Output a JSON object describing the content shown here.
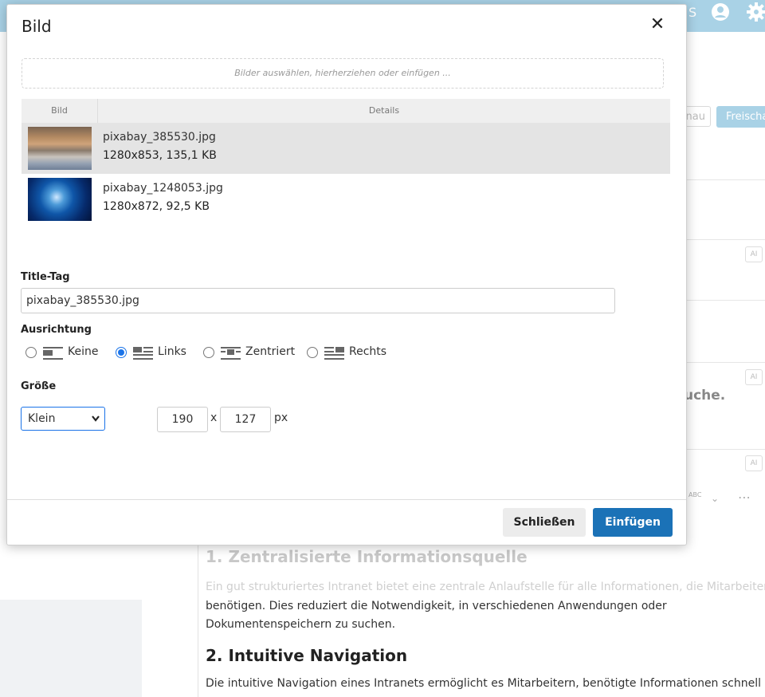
{
  "background": {
    "header_icons": [
      "S",
      "my-account-icon",
      "gear-icon"
    ],
    "buttons": {
      "preview": "nau",
      "publish": "Freischa"
    },
    "partial_heading": "uche.",
    "toolbar": {
      "spellcheck_label": "ABC"
    },
    "content": {
      "h1": "1. Zentralisierte Informationsquelle",
      "p1_faded": "Ein gut strukturiertes Intranet bietet eine zentrale Anlaufstelle für alle Informationen, die Mitarbeiter",
      "p1": "benötigen. Dies reduziert die Notwendigkeit, in verschiedenen Anwendungen oder Dokumentenspeichern zu suchen.",
      "h2": "2. Intuitive Navigation",
      "p2": "Die intuitive Navigation eines Intranets ermöglicht es Mitarbeitern, benötigte Informationen schnell zu"
    },
    "ai_badge": "AI"
  },
  "dialog": {
    "title": "Bild",
    "close_symbol": "✕",
    "dropzone_text": "Bilder auswählen, hierherziehen oder einfügen ...",
    "table": {
      "headers": [
        "Bild",
        "Details"
      ],
      "rows": [
        {
          "filename": "pixabay_385530.jpg",
          "meta": "1280x853, 135,1 KB",
          "selected": true
        },
        {
          "filename": "pixabay_1248053.jpg",
          "meta": "1280x872, 92,5 KB",
          "selected": false
        }
      ]
    },
    "title_tag": {
      "label": "Title-Tag",
      "value": "pixabay_385530.jpg"
    },
    "alignment": {
      "label": "Ausrichtung",
      "options": [
        "Keine",
        "Links",
        "Zentriert",
        "Rechts"
      ],
      "selected": "Links"
    },
    "size": {
      "label": "Größe",
      "preset": "Klein",
      "width": "190",
      "height": "127",
      "separator": "x",
      "unit": "px"
    },
    "buttons": {
      "close": "Schließen",
      "insert": "Einfügen"
    }
  }
}
